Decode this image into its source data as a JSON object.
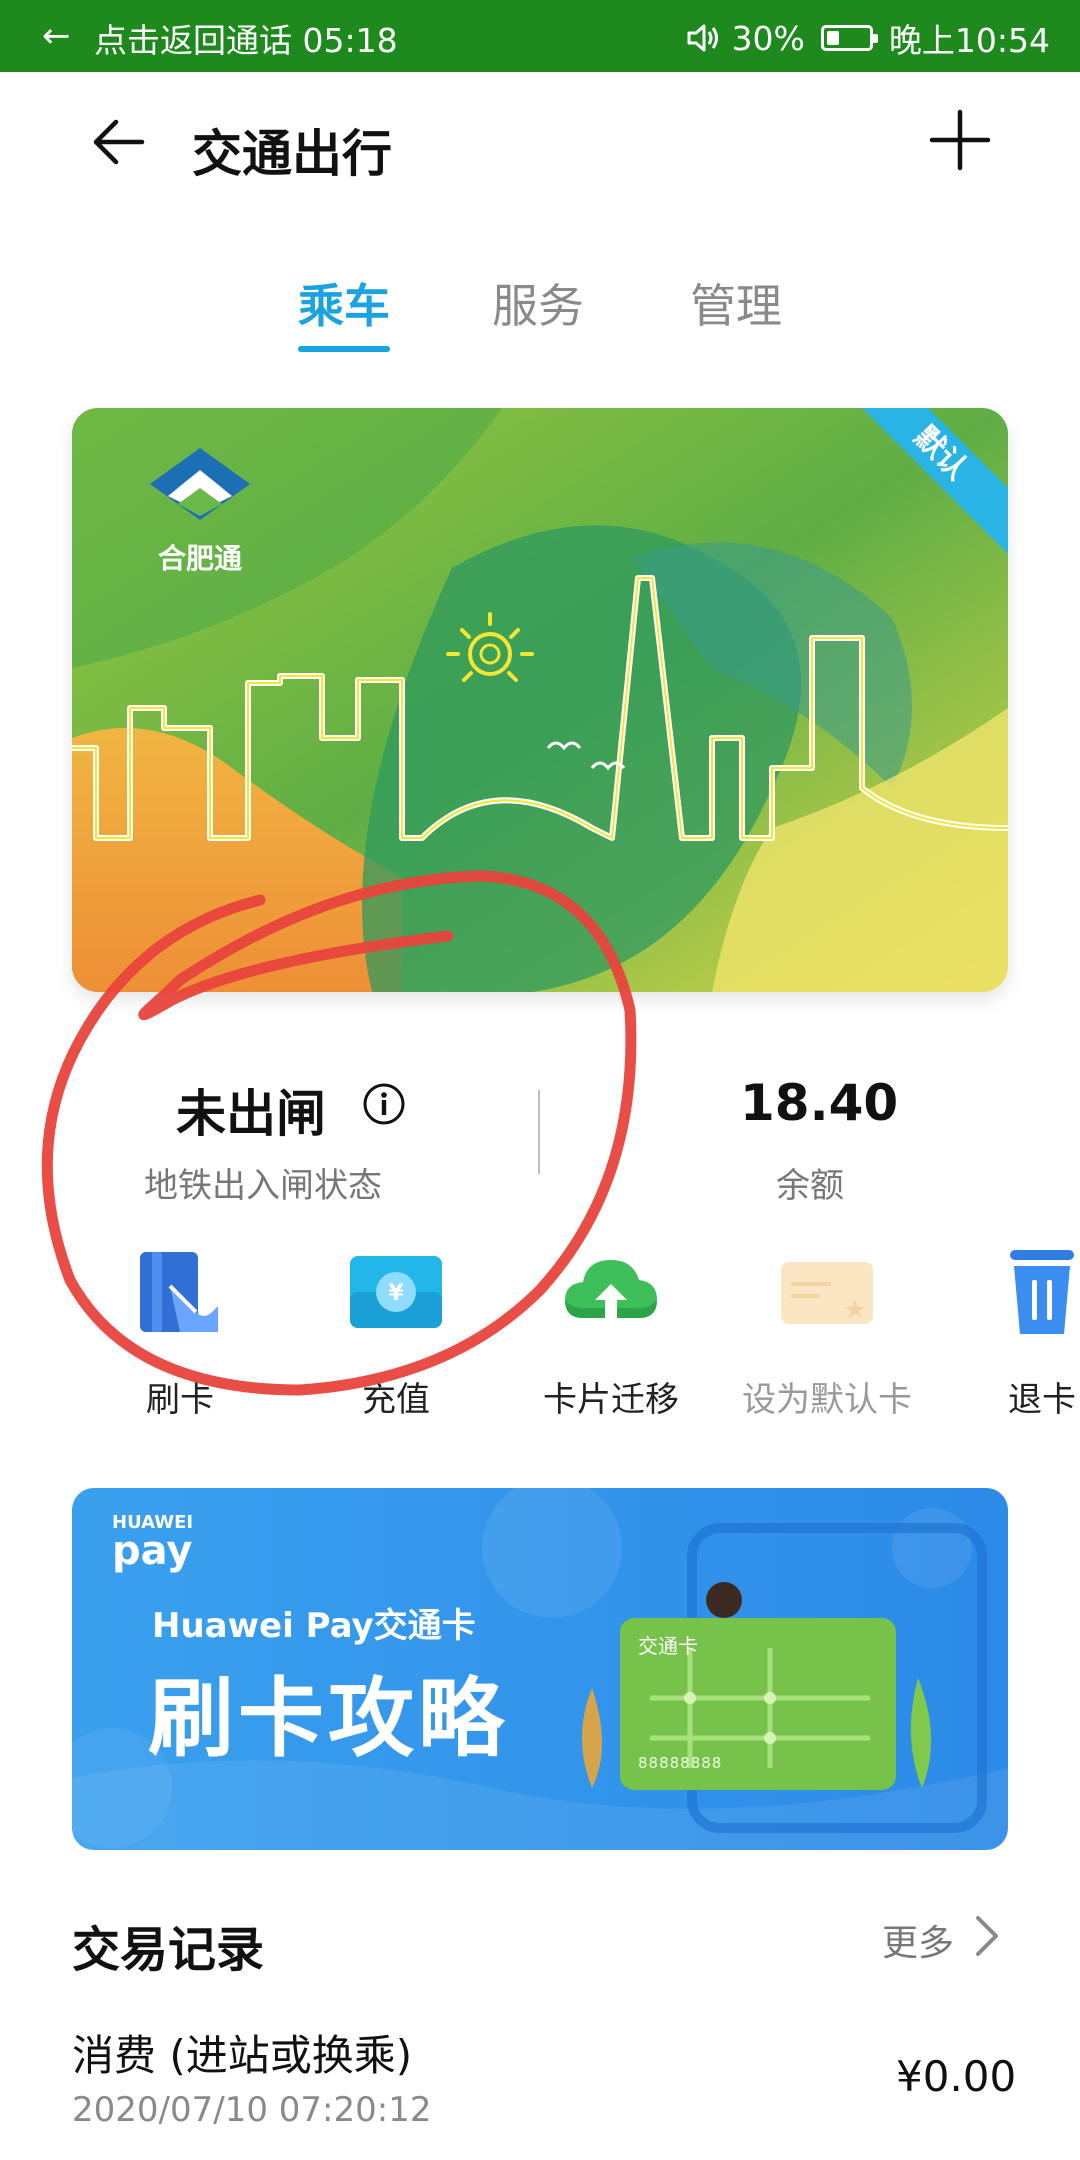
{
  "status_bar": {
    "call_text": "点击返回通话 05:18",
    "battery_text": "30%",
    "battery_level": 0.3,
    "time_text": "晚上10:54",
    "icons": [
      "back-arrow-icon",
      "speaker-icon",
      "battery-icon"
    ]
  },
  "header": {
    "title": "交通出行",
    "icons": [
      "back-arrow-icon",
      "plus-icon"
    ]
  },
  "tabs": [
    {
      "label": "乘车",
      "active": true
    },
    {
      "label": "服务",
      "active": false
    },
    {
      "label": "管理",
      "active": false
    }
  ],
  "card": {
    "logo_text": "合肥通",
    "default_badge": "默认"
  },
  "stats": {
    "gate_status": "未出闸",
    "gate_label": "地铁出入闸状态",
    "balance": "18.40",
    "balance_label": "余额"
  },
  "actions": [
    {
      "label": "刷卡",
      "icon": "card-swipe-icon"
    },
    {
      "label": "充值",
      "icon": "recharge-icon"
    },
    {
      "label": "卡片迁移",
      "icon": "cloud-upload-icon"
    },
    {
      "label": "设为默认卡",
      "icon": "default-card-icon",
      "disabled": true
    },
    {
      "label": "退卡",
      "icon": "trash-icon"
    }
  ],
  "banner": {
    "brand_small": "HUAWEI",
    "brand_big": "pay",
    "subtitle": "Huawei Pay交通卡",
    "headline": "刷卡攻略",
    "mini_card_title": "交通卡",
    "mini_card_number": "88888888"
  },
  "records": {
    "title": "交易记录",
    "more": "更多",
    "items": [
      {
        "title": "消费 (进站或换乘)",
        "time": "2020/07/10 07:20:12",
        "amount": "¥0.00"
      }
    ]
  },
  "colors": {
    "status_bar": "#1e8a1e",
    "accent": "#1aa3e0",
    "annotation": "#e8453c"
  }
}
